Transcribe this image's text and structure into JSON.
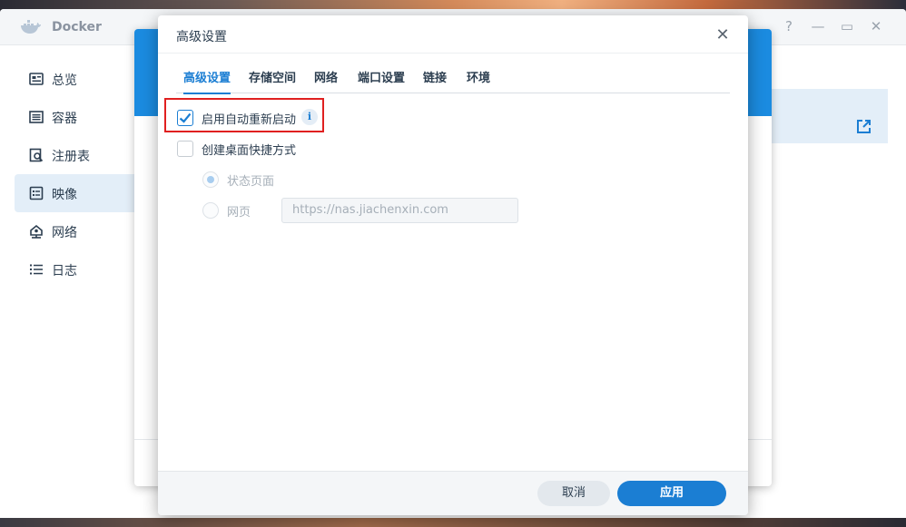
{
  "app": {
    "title": "Docker",
    "window_controls": [
      "?",
      "—",
      "▭",
      "✕"
    ]
  },
  "sidebar": {
    "items": [
      {
        "label": "总览",
        "icon": "overview-icon"
      },
      {
        "label": "容器",
        "icon": "container-icon"
      },
      {
        "label": "注册表",
        "icon": "registry-icon"
      },
      {
        "label": "映像",
        "icon": "image-icon",
        "active": true
      },
      {
        "label": "网络",
        "icon": "network-icon"
      },
      {
        "label": "日志",
        "icon": "log-icon"
      }
    ]
  },
  "dialog": {
    "title": "高级设置",
    "close_label": "✕",
    "tabs": [
      "高级设置",
      "存储空间",
      "网络",
      "端口设置",
      "链接",
      "环境"
    ],
    "active_tab": "高级设置",
    "options": {
      "auto_restart": {
        "label": "启用自动重新启动",
        "checked": true
      },
      "desktop_shortcut": {
        "label": "创建桌面快捷方式",
        "checked": false
      }
    },
    "shortcut_options": {
      "status_page": {
        "label": "状态页面",
        "selected": true,
        "disabled": true
      },
      "web_page": {
        "label": "网页",
        "selected": false,
        "disabled": true
      }
    },
    "url_field": {
      "value": "https://nas.jiachenxin.com"
    },
    "info_icon": "i",
    "buttons": {
      "cancel": "取消",
      "apply": "应用"
    }
  },
  "colors": {
    "accent": "#1b7ed3",
    "active_bg": "#e3eef8",
    "highlight": "#e02020"
  }
}
